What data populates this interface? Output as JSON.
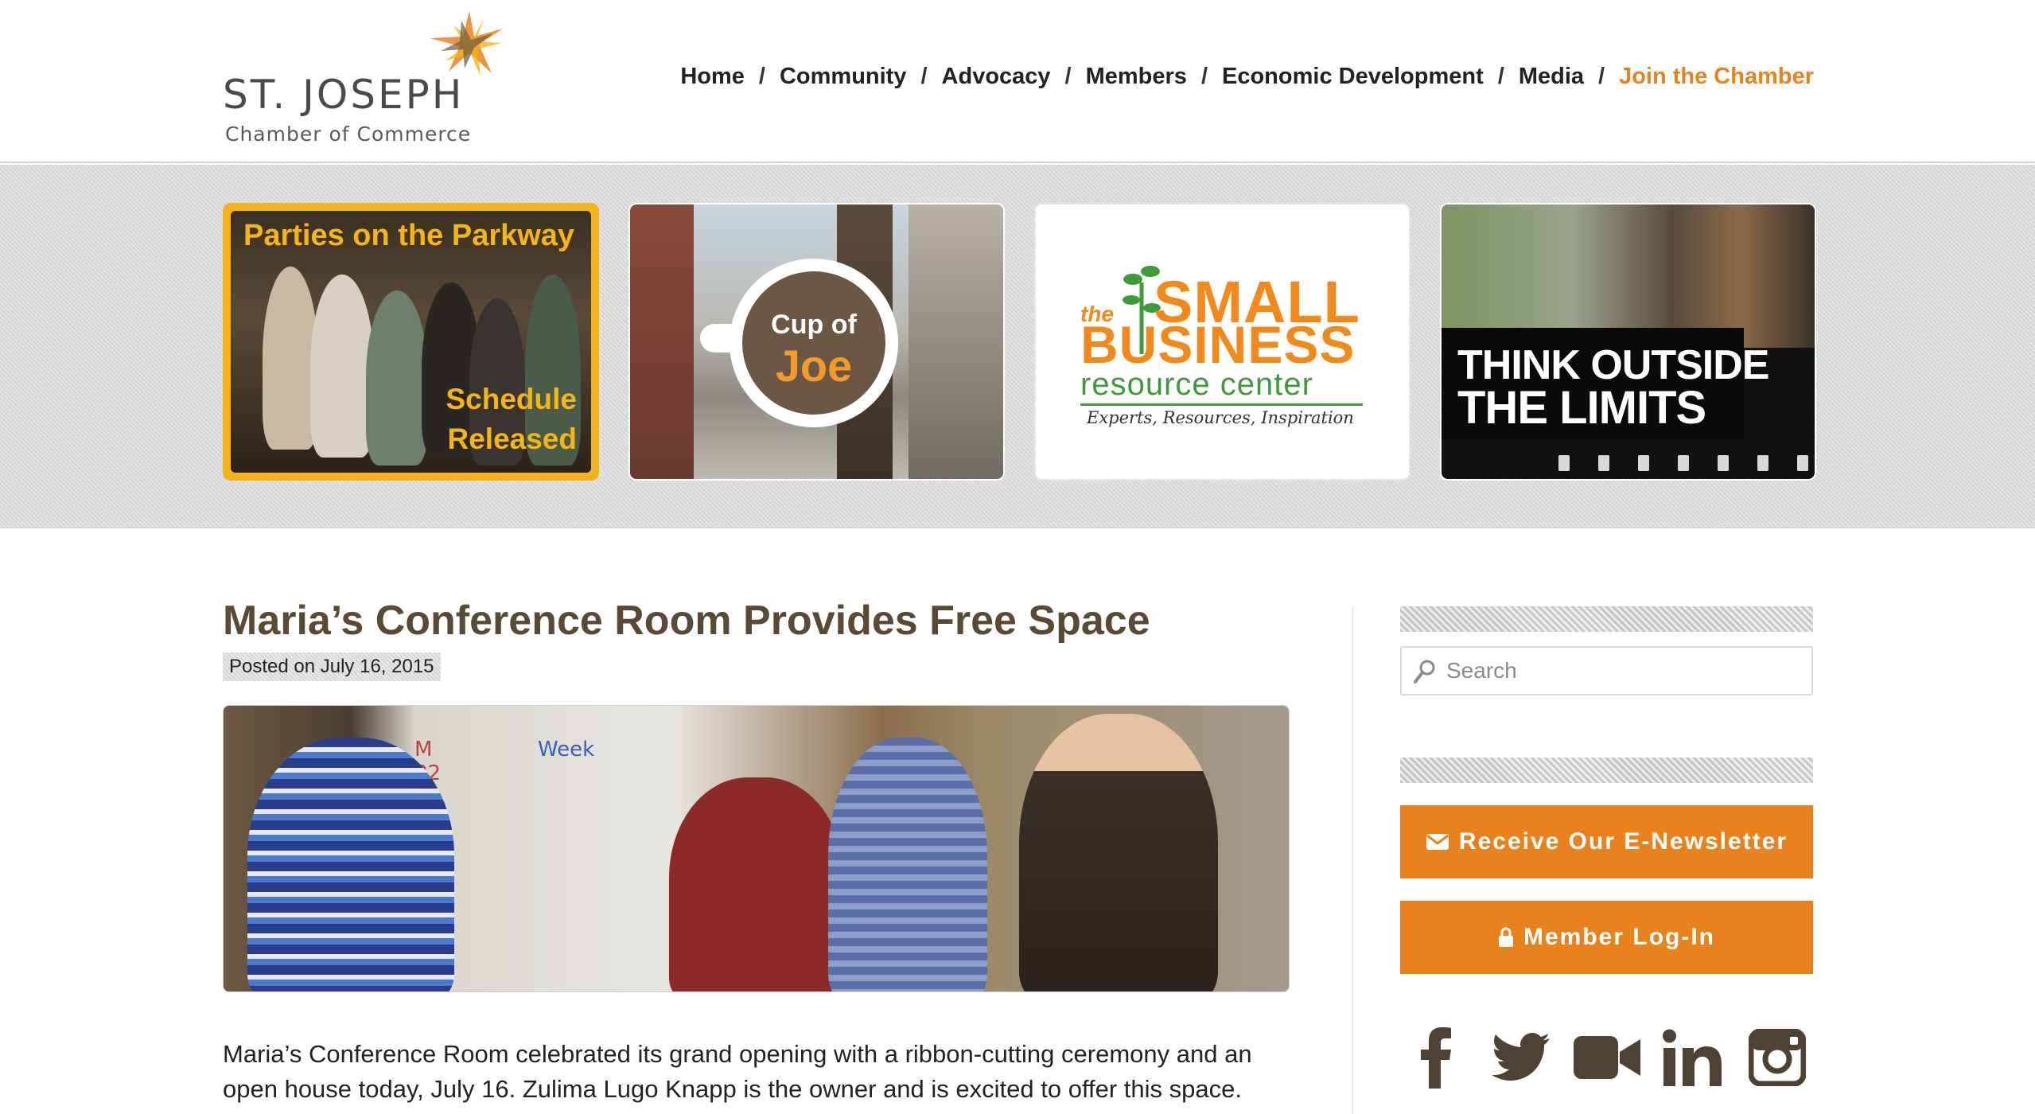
{
  "logo": {
    "name": "ST. JOSEPH",
    "subtitle": "Chamber of Commerce"
  },
  "nav": {
    "items": [
      "Home",
      "Community",
      "Advocacy",
      "Members",
      "Economic Development",
      "Media",
      "Join the Chamber"
    ],
    "separator": "/",
    "accent_color": "#e8821c"
  },
  "promos": {
    "parties": {
      "title": "Parties on the Parkway",
      "line1": "Schedule",
      "line2": "Released"
    },
    "cup": {
      "line1": "Cup of",
      "line2": "Joe"
    },
    "sbrc": {
      "the": "the",
      "small": "SMALL",
      "business": "BUSINESS",
      "resource": "resource center",
      "tagline": "Experts, Resources, Inspiration"
    },
    "limits": {
      "line1": "THINK OUTSIDE",
      "line2": "THE LIMITS"
    }
  },
  "post": {
    "title": "Maria’s Conference Room Provides Free Space",
    "meta": "Posted on July 16, 2015",
    "body": "Maria’s Conference Room celebrated its grand opening with a ribbon-cutting ceremony and an open house today, July 16. Zulima Lugo Knapp is the owner and is excited to offer this space. The"
  },
  "sidebar": {
    "search_placeholder": "Search",
    "newsletter_label": "Receive Our E-Newsletter",
    "login_label": "Member Log-In",
    "social": [
      "facebook-icon",
      "twitter-icon",
      "video-icon",
      "linkedin-icon",
      "instagram-icon"
    ],
    "icon_color": "#4d4233",
    "button_color": "#e8821c"
  }
}
